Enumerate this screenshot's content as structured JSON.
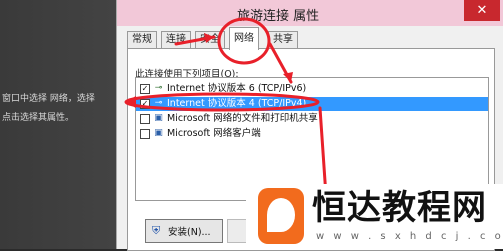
{
  "background": {
    "lines": [
      "窗口中选择 网络，选择",
      "点击选择其属性。"
    ]
  },
  "dialog": {
    "title": "旅游连接 属性",
    "close_glyph": "✕",
    "tabs": [
      {
        "label": "常规"
      },
      {
        "label": "连接"
      },
      {
        "label": "安全"
      },
      {
        "label": "网络"
      },
      {
        "label": "共享"
      }
    ],
    "active_tab": "网络",
    "items_label": "此连接使用下列项目(O):",
    "items": [
      {
        "label": "Internet 协议版本 6 (TCP/IPv6)",
        "checked": true,
        "icon": "network-protocol-icon"
      },
      {
        "label": "Internet 协议版本 4 (TCP/IPv4)",
        "checked": true,
        "selected": true,
        "icon": "network-protocol-icon"
      },
      {
        "label": "Microsoft 网络的文件和打印机共享",
        "checked": false,
        "icon": "network-share-icon"
      },
      {
        "label": "Microsoft 网络客户端",
        "checked": false,
        "icon": "network-client-icon"
      }
    ],
    "install_button": "安装(N)...",
    "install_icon": "uac-shield-icon"
  },
  "watermark": {
    "title": "恒达教程网",
    "url": "w w w . s x h d c j . c o m",
    "logo_color": "#f26b1d"
  },
  "annotation_color": "#e8202a"
}
